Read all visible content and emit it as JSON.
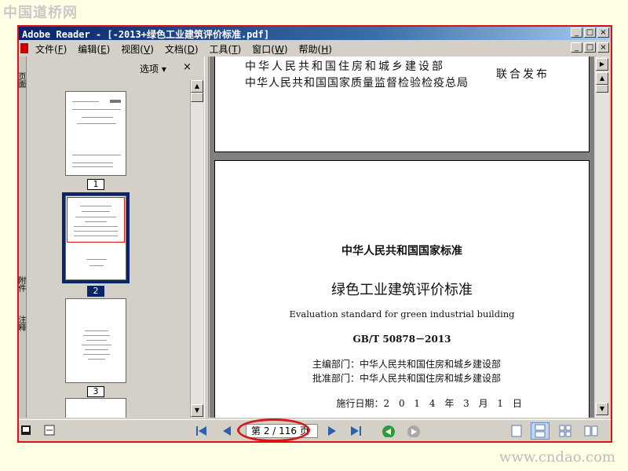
{
  "watermark": {
    "top": "中国道桥网",
    "bottom": "www.cndao.com"
  },
  "window": {
    "title": "Adobe Reader - [-2013+绿色工业建筑评价标准.pdf]",
    "controls": [
      "_",
      "□",
      "×"
    ]
  },
  "menu": [
    {
      "label": "文件",
      "key": "F"
    },
    {
      "label": "编辑",
      "key": "E"
    },
    {
      "label": "视图",
      "key": "V"
    },
    {
      "label": "文档",
      "key": "D"
    },
    {
      "label": "工具",
      "key": "T"
    },
    {
      "label": "窗口",
      "key": "W"
    },
    {
      "label": "帮助",
      "key": "H"
    }
  ],
  "left_tabs": [
    "页面",
    "附件",
    "注释"
  ],
  "sidebar": {
    "options_label": "选项",
    "options_arrow": "▾",
    "close": "×",
    "thumbnails": [
      {
        "label": "1",
        "selected": false
      },
      {
        "label": "2",
        "selected": true
      },
      {
        "label": "3",
        "selected": false
      }
    ]
  },
  "page_prev": {
    "line1": "中华人民共和国住房和城乡建设部",
    "line2": "中华人民共和国国家质量监督检验检疫总局",
    "joint": "联合发布"
  },
  "page_current": {
    "national_standard": "中华人民共和国国家标准",
    "title_cn": "绿色工业建筑评价标准",
    "title_en": "Evaluation standard for green industrial building",
    "code": "GB/T 50878－2013",
    "editor_label": "主编部门：",
    "editor": "中华人民共和国住房和城乡建设部",
    "approver_label": "批准部门：",
    "approver": "中华人民共和国住房和城乡建设部",
    "date_label": "施行日期：",
    "date": "2 0 1 4 年 3 月 1 日"
  },
  "navigation": {
    "page_field": "第 2 / 116 页",
    "current_page": 2,
    "total_pages": 116
  },
  "colors": {
    "annotation_red": "#d21a1a",
    "titlebar": "#0a246a",
    "selection": "#0a246a"
  }
}
